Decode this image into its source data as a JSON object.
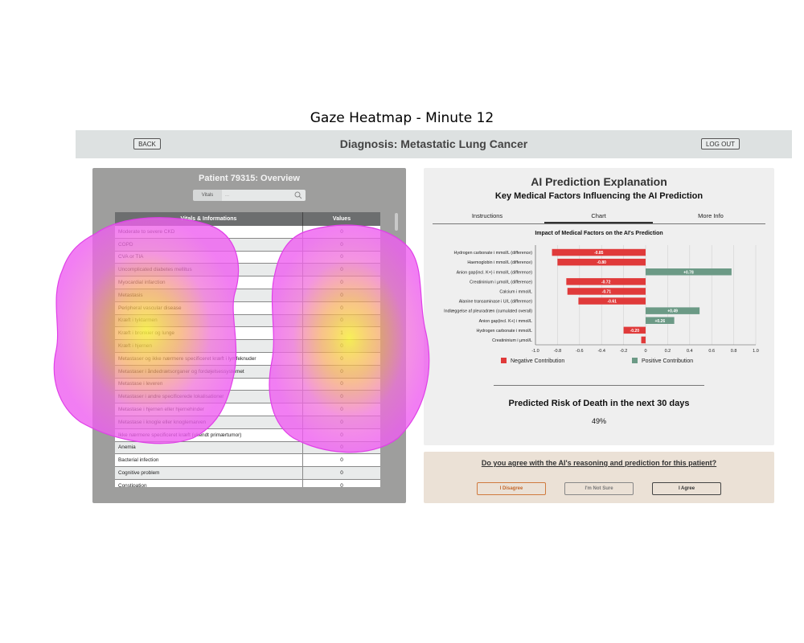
{
  "figure_title": "Gaze Heatmap - Minute 12",
  "header": {
    "back_label": "BACK",
    "title": "Diagnosis: Metastatic Lung Cancer",
    "logout_label": "LOG OUT"
  },
  "patient": {
    "title": "Patient 79315: Overview",
    "search_scope": "Vitals",
    "search_placeholder": "...",
    "table_headers": {
      "col1": "Vitals & Informations",
      "col2": "Values"
    },
    "rows": [
      {
        "label": "Moderate to severe CKD",
        "value": "0"
      },
      {
        "label": "COPD",
        "value": "0"
      },
      {
        "label": "CVA or TIA",
        "value": "0"
      },
      {
        "label": "Uncomplicated diabetes mellitus",
        "value": "0"
      },
      {
        "label": "Myocardial infarction",
        "value": "0"
      },
      {
        "label": "Metastasis",
        "value": "0"
      },
      {
        "label": "Peripheral vascular disease",
        "value": "0"
      },
      {
        "label": "Kræft i tyktarmen",
        "value": "0"
      },
      {
        "label": "Kræft i bronkier og lunge",
        "value": "1"
      },
      {
        "label": "Kræft i hjernen",
        "value": "0"
      },
      {
        "label": "Metastaser og ikke nærmere specificeret kræft i lymfeknuder",
        "value": "0"
      },
      {
        "label": "Metastaser i åndedrætsorganer og fordøjelsessystemet",
        "value": "0"
      },
      {
        "label": "Metastase i leveren",
        "value": "0"
      },
      {
        "label": "Metastaser i andre specificerede lokalisationer",
        "value": "0"
      },
      {
        "label": "Metastase i hjernen eller hjernehinder",
        "value": "0"
      },
      {
        "label": "Metastase i knogle eller knoglemarven",
        "value": "0"
      },
      {
        "label": "Ikke nærmere specificeret kræft (ukendt primærtumor)",
        "value": "0"
      },
      {
        "label": "Anemia",
        "value": "0"
      },
      {
        "label": "Bacterial infection",
        "value": "0"
      },
      {
        "label": "Cognitive problem",
        "value": "0"
      },
      {
        "label": "Constipation",
        "value": "0"
      }
    ]
  },
  "ai": {
    "title": "AI Prediction Explanation",
    "subtitle": "Key Medical Factors Influencing the AI Prediction",
    "tabs": [
      "Instructions",
      "Chart",
      "More Info"
    ],
    "active_tab": "Chart",
    "legend_negative": "Negative Contribution",
    "legend_positive": "Positive Contribution",
    "negative_color": "#e03a3a",
    "positive_color": "#6c9a86",
    "risk_title": "Predicted Risk of Death in the next 30 days",
    "risk_value": "49%"
  },
  "chart_data": {
    "type": "bar",
    "orientation": "horizontal",
    "title": "Impact of Medical Factors on the AI's Prediction",
    "categories": [
      "Hydrogen carbonate i mmol/L (difference)",
      "Haemoglobin i mmol/L (difference)",
      "Anion gap(incl. K+) i mmol/L (difference)",
      "Creatininium i µmol/L (difference)",
      "Calcium i mmol/L",
      "Alanine transaminase i U/L (difference)",
      "Indlæggelse af pleuradræn (cumulated overall)",
      "Anion gap(incl. K+) i mmol/L",
      "Hydrogen carbonate i mmol/L",
      "Creatininium i µmol/L"
    ],
    "values": [
      -0.85,
      -0.8,
      0.78,
      -0.72,
      -0.71,
      -0.61,
      0.49,
      0.26,
      -0.2,
      -0.04
    ],
    "data_labels": [
      "-0.85",
      "-0.80",
      "+0.78",
      "-0.72",
      "-0.71",
      "-0.61",
      "+0.49",
      "+0.26",
      "-0.20",
      ""
    ],
    "xlim": [
      -1.0,
      1.0
    ],
    "xticks": [
      "-1.0",
      "-0.8",
      "-0.6",
      "-0.4",
      "-0.2",
      "0",
      "0.2",
      "0.4",
      "0.6",
      "0.8",
      "1.0"
    ],
    "grid": true,
    "legend": [
      "Negative Contribution",
      "Positive Contribution"
    ],
    "legend_position": "bottom"
  },
  "feedback": {
    "question": "Do you agree with the AI's reasoning and prediction for this patient?",
    "disagree_label": "I Disagree",
    "not_sure_label": "I'm Not Sure",
    "agree_label": "I Agree"
  }
}
